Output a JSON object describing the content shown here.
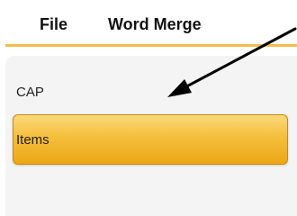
{
  "menubar": {
    "file_label": "File",
    "word_merge_label": "Word Merge"
  },
  "list": {
    "items": [
      {
        "label": "CAP",
        "selected": false
      },
      {
        "label": "Items",
        "selected": true
      }
    ]
  },
  "colors": {
    "accent_line": "#f1c04a",
    "selected_item_top": "#fbd97a",
    "selected_item_bottom": "#eca716",
    "panel_background": "#f4f4f4",
    "arrow": "#000000"
  },
  "annotation": {
    "icon": "arrow-pointer-icon"
  }
}
